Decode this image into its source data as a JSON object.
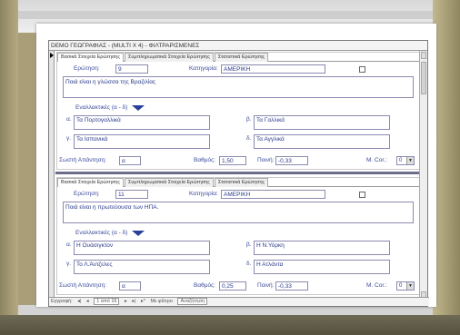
{
  "window": {
    "title": "DEMO ΓΕΩΓΡΑΦΙΑΣ - (MULTI X 4) - ΦΙΛΤΡΑΡΙΣΜΕΝΕΣ"
  },
  "tabs": [
    {
      "label": "Βασικά Στοιχεία Ερώτησης",
      "active": true
    },
    {
      "label": "Συμπληρωματικά Στοιχεία Ερώτησης",
      "active": false
    },
    {
      "label": "Στατιστικά Ερώτησης",
      "active": false
    }
  ],
  "labels": {
    "question": "Ερώτηση:",
    "category": "Κατηγορία:",
    "alternatives": "Εναλλακτικές (α - δ)",
    "alpha": "α.",
    "beta": "β.",
    "gamma": "γ.",
    "delta": "δ.",
    "correct": "Σωστή Απάντηση:",
    "grade": "Βαθμός:",
    "penalty": "Ποινή:",
    "mcor": "Μ. Cor.:"
  },
  "records": [
    {
      "question_no": "9",
      "category": "ΑΜΕΡΙΚΗ",
      "question_text": "Ποιά είναι η γλώσσα της Βραζιλίας",
      "answers": {
        "a": "Τα Πορτογαλλικά",
        "b": "Τα Γαλλικά",
        "c": "Τα Ισπανικά",
        "d": "Τα Αγγλικά"
      },
      "correct": "α",
      "grade": "1,50",
      "penalty": "-0,33",
      "mcor": "0"
    },
    {
      "question_no": "11",
      "category": "ΑΜΕΡΙΚΗ",
      "question_text": "Ποιά είναι η πρωτεύουσα των ΗΠΑ.",
      "answers": {
        "a": "Η Ουάσιγκτον",
        "b": "Η Ν.Υόρκη",
        "c": "Το Λ.Άντζελες",
        "d": "Η Ατλάντα"
      },
      "correct": "α",
      "grade": "0,25",
      "penalty": "-0,33",
      "mcor": "0"
    }
  ],
  "record_nav": {
    "label": "Εγγραφή:",
    "position": "1 από 16",
    "filter": "Με φίλτρο",
    "search": "Αναζήτηση"
  },
  "colors": {
    "accent": "#2a3f9a",
    "text": "#1a2a6a",
    "background": "#a99e77"
  }
}
